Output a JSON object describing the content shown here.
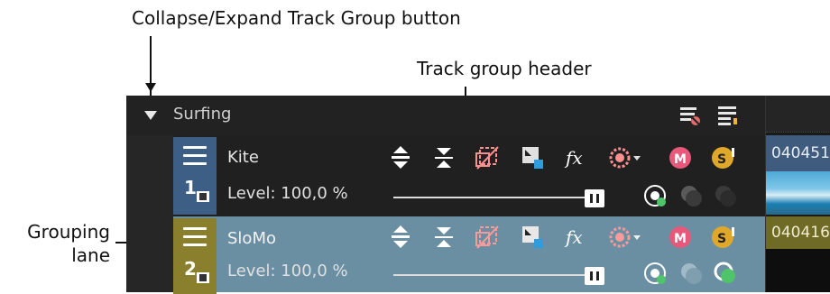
{
  "annotations": {
    "collapse_label": "Collapse/Expand Track Group button",
    "header_label": "Track group header",
    "lane_label_line1": "Grouping",
    "lane_label_line2": "lane"
  },
  "group": {
    "name": "Surfing",
    "header_icons": [
      "collapse-triangle-icon",
      "remove-group-filter-icon",
      "group-settings-icon"
    ]
  },
  "tracks": [
    {
      "number": "1",
      "name": "Kite",
      "level": "Level: 100,0 %",
      "level_value": 100,
      "color": "#3d5f86",
      "clip_label": "040451",
      "icons": [
        "expand-track-icon",
        "minimize-track-icon",
        "bypass-motion-blur-icon",
        "compositing-icon",
        "fx-icon",
        "composite-mode-icon",
        "mute-icon",
        "solo-icon",
        "automation-icon",
        "envelope-icon",
        "bus-icon"
      ]
    },
    {
      "number": "2",
      "name": "SloMo",
      "level": "Level: 100,0 %",
      "level_value": 100,
      "color": "#8a7f2c",
      "clip_label": "040416",
      "icons": [
        "expand-track-icon",
        "minimize-track-icon",
        "bypass-motion-blur-icon",
        "compositing-icon",
        "fx-icon",
        "composite-mode-icon",
        "mute-icon",
        "solo-icon",
        "automation-icon",
        "envelope-icon",
        "bus-icon"
      ]
    }
  ]
}
